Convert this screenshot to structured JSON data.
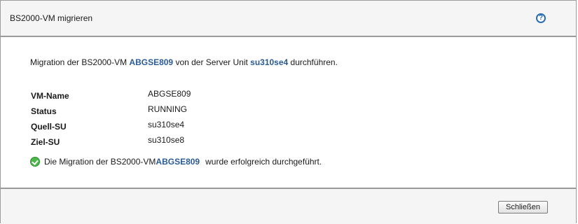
{
  "dialog": {
    "title": "BS2000-VM migrieren",
    "help_icon": "?"
  },
  "intro": {
    "prefix": "Migration der BS2000-VM ",
    "vm": "ABGSE809",
    "middle": " von der Server Unit ",
    "su": "su310se4",
    "suffix": " durchführen."
  },
  "details": [
    {
      "label": "VM-Name",
      "value": "ABGSE809"
    },
    {
      "label": "Status",
      "value": "RUNNING"
    },
    {
      "label": "Quell-SU",
      "value": "su310se4"
    },
    {
      "label": "Ziel-SU",
      "value": "su310se8"
    }
  ],
  "result": {
    "prefix": "Die Migration der BS2000-VM ",
    "vm": "ABGSE809",
    "suffix": "wurde erfolgreich durchgeführt."
  },
  "footer": {
    "close_label": "Schließen"
  },
  "colors": {
    "highlight": "#2a5a96",
    "success": "#4db84a",
    "help": "#2a6db5"
  },
  "icons": {
    "help": "help-icon",
    "success": "check-circle-icon"
  }
}
